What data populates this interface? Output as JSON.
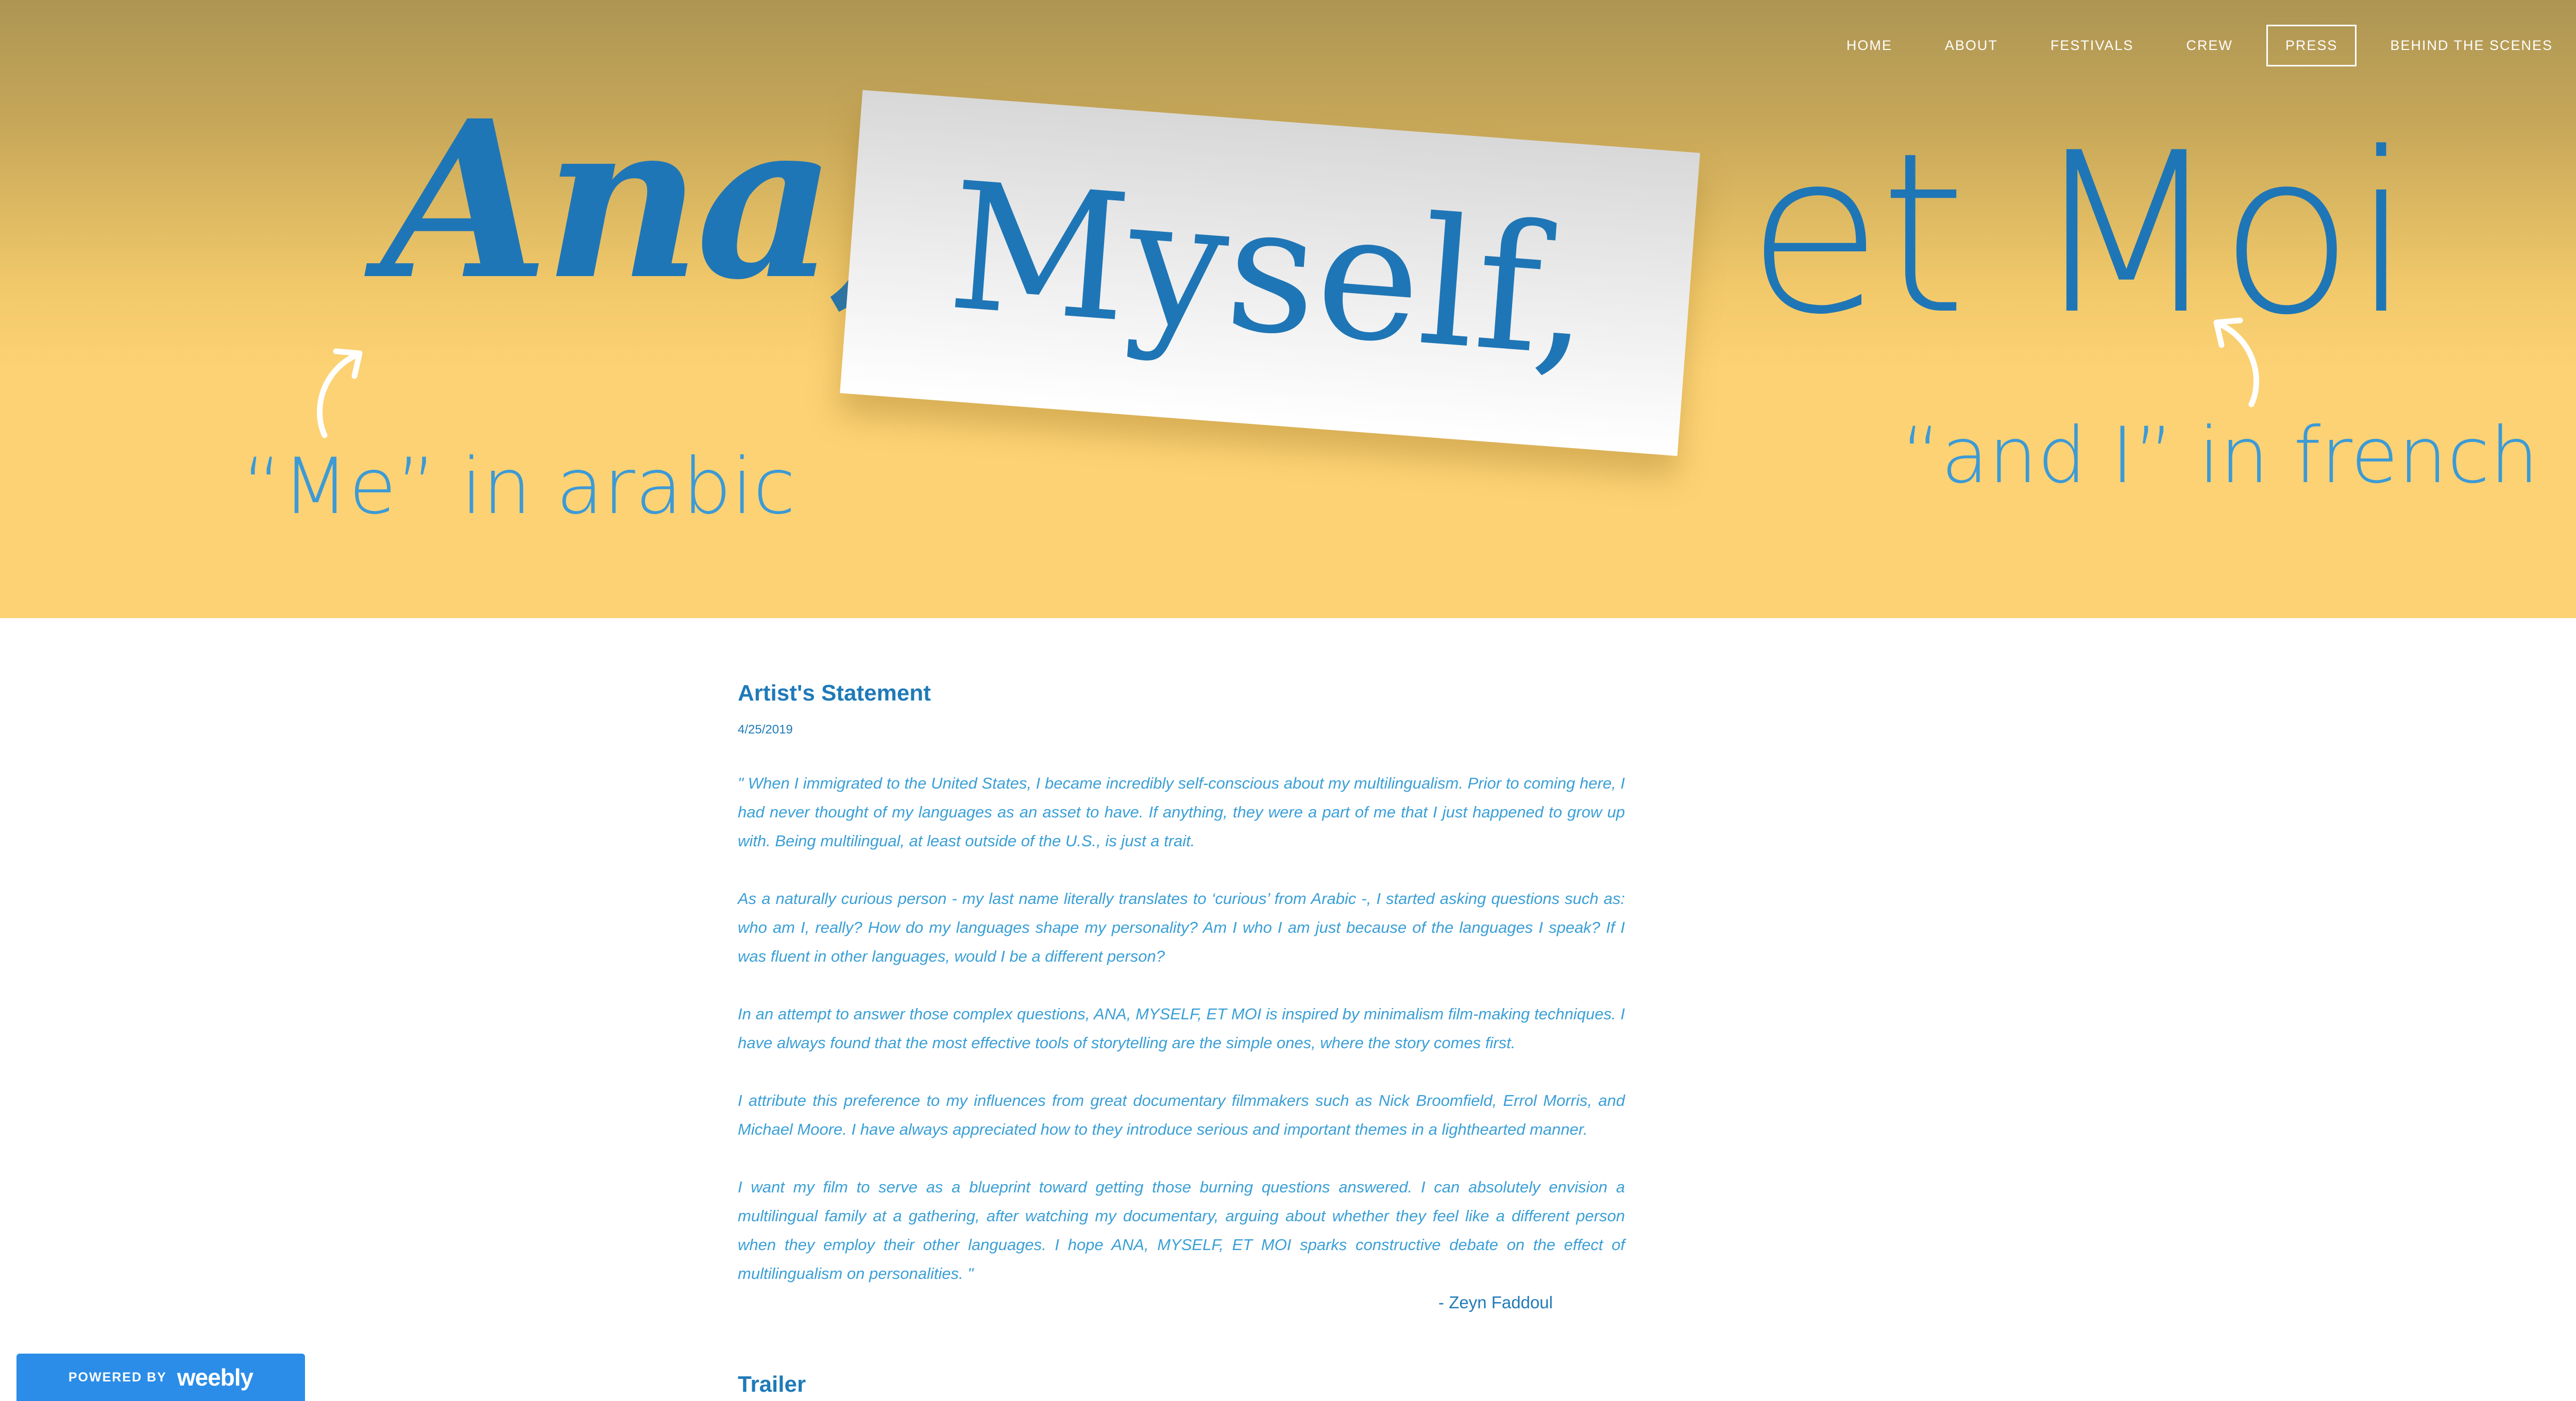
{
  "nav": {
    "items": [
      {
        "label": "HOME"
      },
      {
        "label": "ABOUT"
      },
      {
        "label": "FESTIVALS"
      },
      {
        "label": "CREW"
      },
      {
        "label": "PRESS",
        "active": true
      },
      {
        "label": "BEHIND THE SCENES"
      }
    ]
  },
  "banner": {
    "word_1": "Ana,",
    "word_2": "Myself,",
    "word_3": "et Moi",
    "note_left": "“Me” in arabic",
    "note_right": "“and I” in french"
  },
  "post": {
    "title": "Artist's Statement",
    "date": "4/25/2019",
    "paragraphs": [
      "\" When I immigrated to the United States, I became incredibly self-conscious about my multilingualism. Prior to coming here, I had never thought of my languages as an asset to have. If anything, they were a part of me that I just happened to grow up with. Being multilingual, at least outside of the U.S., is just a trait.",
      "As a naturally curious person - my last name literally translates to ‘curious’ from Arabic -, I started asking questions such as: who am I, really? How do my languages shape my personality? Am I who I am just because of the languages I speak? If I was fluent in other languages, would I be a different person?",
      "In an attempt to answer those complex questions, ANA, MYSELF, ET MOI is inspired by minimalism film-making techniques. I have always found that the most effective tools of storytelling are the simple ones, where the story comes first.",
      "I attribute this preference to my influences from great documentary filmmakers such as Nick Broomfield, Errol Morris, and Michael Moore. I have always appreciated how to they introduce serious and important themes in a lighthearted manner.",
      "I want my film to serve as a blueprint toward getting those burning questions answered. I can absolutely envision a multilingual family at a gathering, after watching my documentary, arguing about whether they feel like a different person when they employ their other languages. I hope ANA, MYSELF, ET MOI sparks constructive debate on the effect of multilingualism on personalities. \""
    ],
    "signature": "- Zeyn Faddoul"
  },
  "trailer": {
    "title": "Trailer"
  },
  "badge": {
    "powered_by": "POWERED BY",
    "brand": "weebly"
  },
  "colors": {
    "header_top": "#ad9553",
    "header_bottom": "#fcd274",
    "logo_blue": "#1f76b6",
    "note_blue": "#3c9ad6",
    "body_text": "#3a9fd6",
    "badge_blue": "#2b8de8"
  },
  "icons": {
    "arrow_left": "curved-arrow-up-right-icon",
    "arrow_right": "curved-arrow-up-left-icon"
  }
}
